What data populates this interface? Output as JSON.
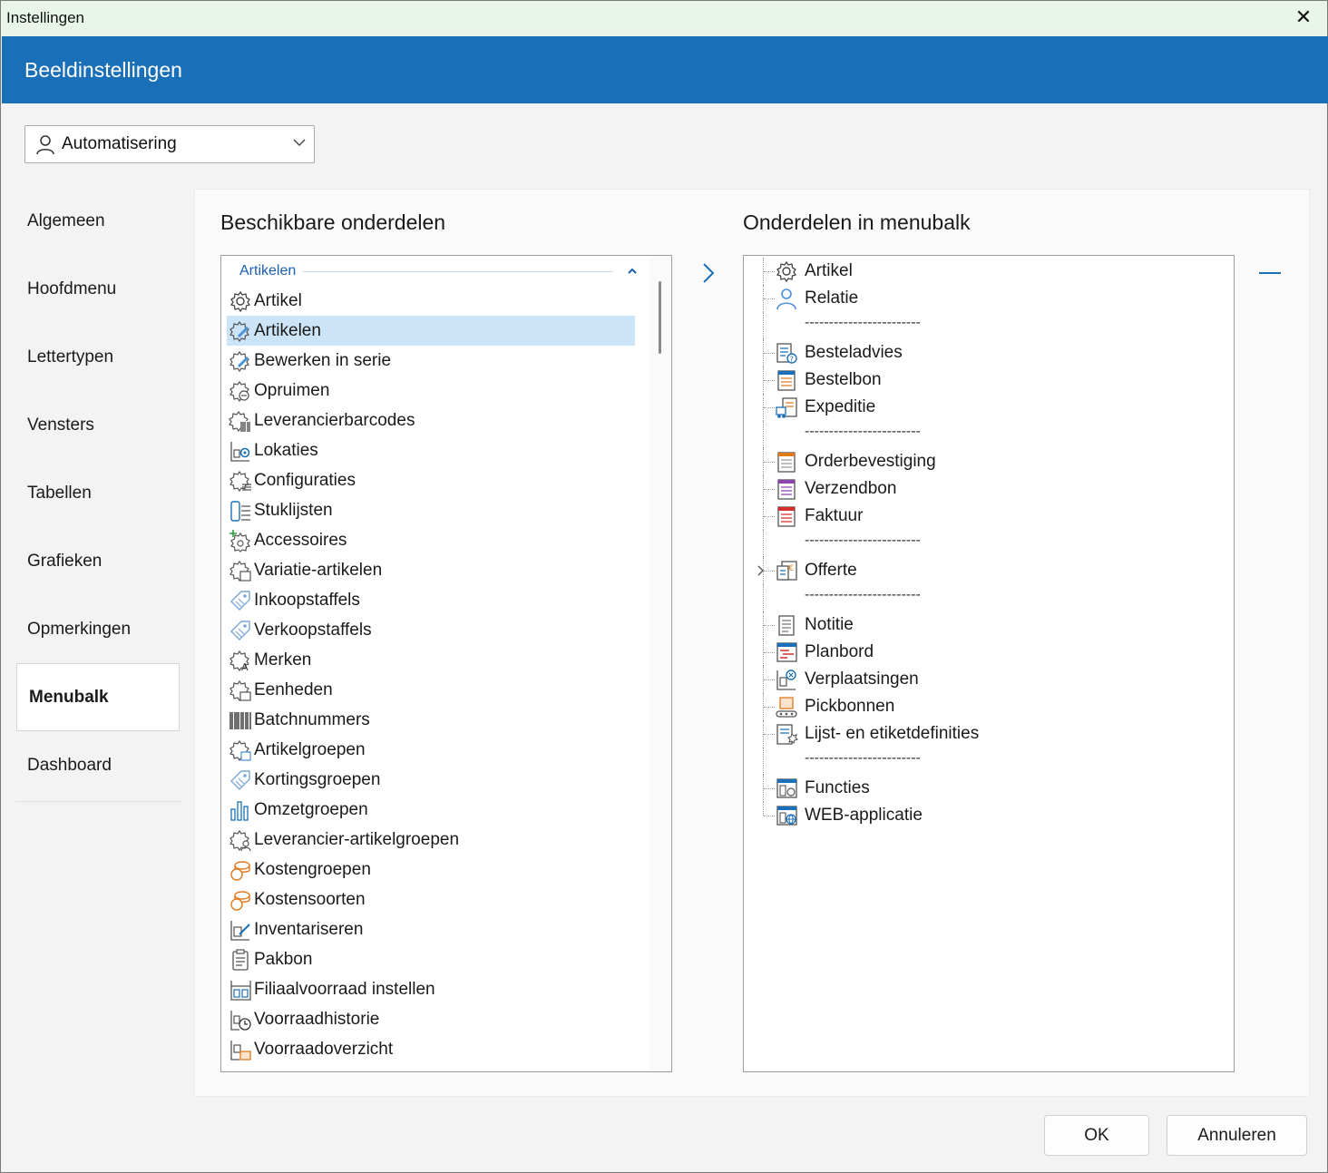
{
  "window": {
    "title": "Instellingen",
    "close_glyph": "✕"
  },
  "banner": {
    "title": "Beeldinstellingen"
  },
  "user_select": {
    "value": "Automatisering",
    "icon": "user-icon"
  },
  "sidebar": {
    "items": [
      {
        "label": "Algemeen"
      },
      {
        "label": "Hoofdmenu"
      },
      {
        "label": "Lettertypen"
      },
      {
        "label": "Vensters"
      },
      {
        "label": "Tabellen"
      },
      {
        "label": "Grafieken"
      },
      {
        "label": "Opmerkingen"
      },
      {
        "label": "Menubalk",
        "active": true
      },
      {
        "label": "Dashboard"
      }
    ]
  },
  "available": {
    "heading": "Beschikbare onderdelen",
    "group": "Artikelen",
    "items": [
      {
        "label": "Artikel",
        "icon": "gear-icon"
      },
      {
        "label": "Artikelen",
        "icon": "gear-edit-icon",
        "selected": true
      },
      {
        "label": "Bewerken in serie",
        "icon": "gear-edit-icon"
      },
      {
        "label": "Opruimen",
        "icon": "gear-clean-icon"
      },
      {
        "label": "Leverancierbarcodes",
        "icon": "gear-barcode-icon"
      },
      {
        "label": "Lokaties",
        "icon": "location-icon"
      },
      {
        "label": "Configuraties",
        "icon": "gear-config-icon"
      },
      {
        "label": "Stuklijsten",
        "icon": "bom-icon"
      },
      {
        "label": "Accessoires",
        "icon": "gear-plus-icon"
      },
      {
        "label": "Variatie-artikelen",
        "icon": "gear-variant-icon"
      },
      {
        "label": "Inkoopstaffels",
        "icon": "tag-icon"
      },
      {
        "label": "Verkoopstaffels",
        "icon": "tag-icon"
      },
      {
        "label": "Merken",
        "icon": "gear-brand-icon"
      },
      {
        "label": "Eenheden",
        "icon": "gear-unit-icon"
      },
      {
        "label": "Batchnummers",
        "icon": "barcode-icon"
      },
      {
        "label": "Artikelgroepen",
        "icon": "gear-group-icon"
      },
      {
        "label": "Kortingsgroepen",
        "icon": "tag-icon"
      },
      {
        "label": "Omzetgroepen",
        "icon": "chart-icon"
      },
      {
        "label": "Leverancier-artikelgroepen",
        "icon": "gear-supplier-icon"
      },
      {
        "label": "Kostengroepen",
        "icon": "coins-icon"
      },
      {
        "label": "Kostensoorten",
        "icon": "coins-icon"
      },
      {
        "label": "Inventariseren",
        "icon": "inventory-icon"
      },
      {
        "label": "Pakbon",
        "icon": "clipboard-icon"
      },
      {
        "label": "Filiaalvoorraad instellen",
        "icon": "warehouse-icon"
      },
      {
        "label": "Voorraadhistorie",
        "icon": "history-icon"
      },
      {
        "label": "Voorraadoverzicht",
        "icon": "stock-icon"
      }
    ]
  },
  "menubar": {
    "heading": "Onderdelen in menubalk",
    "rows": [
      {
        "type": "item",
        "label": "Artikel",
        "icon": "gear-icon"
      },
      {
        "type": "item",
        "label": "Relatie",
        "icon": "person-icon"
      },
      {
        "type": "sep",
        "label": "------------------------"
      },
      {
        "type": "item",
        "label": "Besteladvies",
        "icon": "order-advice-icon"
      },
      {
        "type": "item",
        "label": "Bestelbon",
        "icon": "order-icon"
      },
      {
        "type": "item",
        "label": "Expeditie",
        "icon": "shipping-icon"
      },
      {
        "type": "sep",
        "label": "------------------------"
      },
      {
        "type": "item",
        "label": "Orderbevestiging",
        "icon": "confirmation-icon"
      },
      {
        "type": "item",
        "label": "Verzendbon",
        "icon": "delivery-note-icon"
      },
      {
        "type": "item",
        "label": "Faktuur",
        "icon": "invoice-icon"
      },
      {
        "type": "sep",
        "label": "------------------------"
      },
      {
        "type": "item",
        "label": "Offerte",
        "icon": "quote-icon",
        "expandable": true
      },
      {
        "type": "sep",
        "label": "------------------------"
      },
      {
        "type": "item",
        "label": "Notitie",
        "icon": "note-icon"
      },
      {
        "type": "item",
        "label": "Planbord",
        "icon": "planboard-icon"
      },
      {
        "type": "item",
        "label": "Verplaatsingen",
        "icon": "relocation-icon"
      },
      {
        "type": "item",
        "label": "Pickbonnen",
        "icon": "pick-icon"
      },
      {
        "type": "item",
        "label": "Lijst- en etiketdefinities",
        "icon": "label-def-icon"
      },
      {
        "type": "sep",
        "label": "------------------------"
      },
      {
        "type": "item",
        "label": "Functies",
        "icon": "functions-icon"
      },
      {
        "type": "item",
        "label": "WEB-applicatie",
        "icon": "web-icon"
      }
    ]
  },
  "buttons": {
    "ok": "OK",
    "cancel": "Annuleren"
  },
  "colors": {
    "accent": "#1a70b8",
    "selection": "#cce4f7",
    "group_text": "#1a5fb4"
  }
}
